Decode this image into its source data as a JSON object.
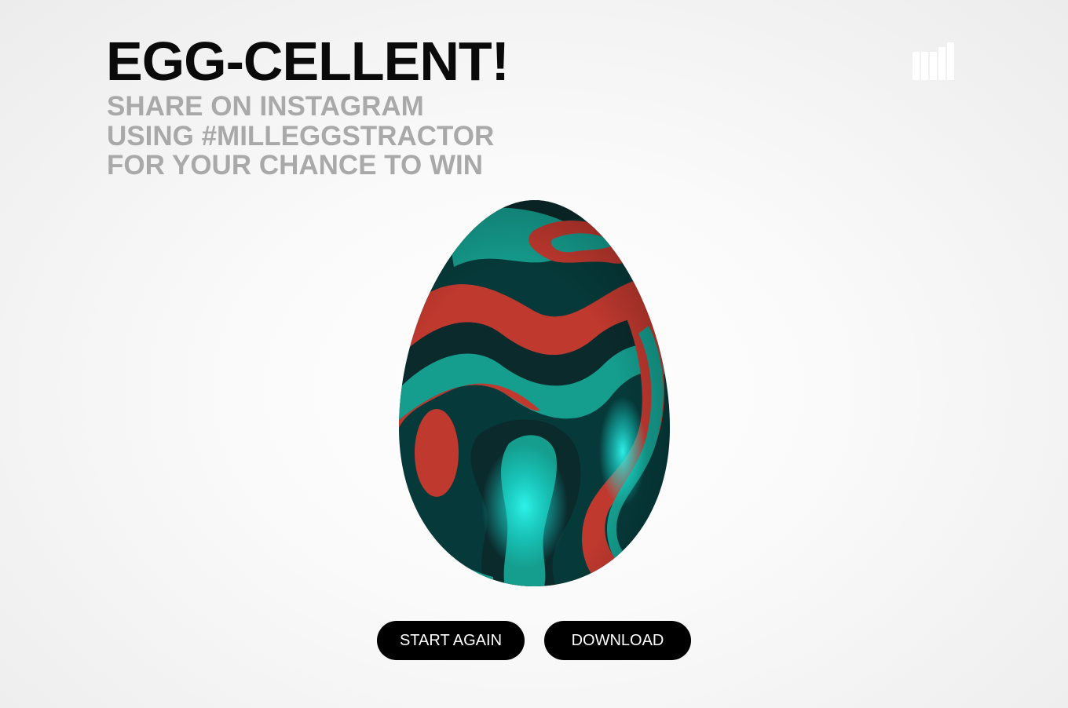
{
  "headline": "EGG-CELLENT!",
  "subline": {
    "line1": "SHARE ON INSTAGRAM",
    "line2": "USING #MILLEGGSTRACTOR",
    "line3": "FOR YOUR CHANCE TO WIN"
  },
  "logo": {
    "icon": "bars-logo-icon",
    "color": "#ffffff"
  },
  "egg": {
    "icon": "decorated-egg-image",
    "colors": {
      "dark": "#0b2a2c",
      "deep": "#063a3a",
      "teal": "#159d8e",
      "red": "#c0392f",
      "highlight": "#19f0e6"
    }
  },
  "actions": {
    "start_again": "START AGAIN",
    "download": "DOWNLOAD"
  }
}
